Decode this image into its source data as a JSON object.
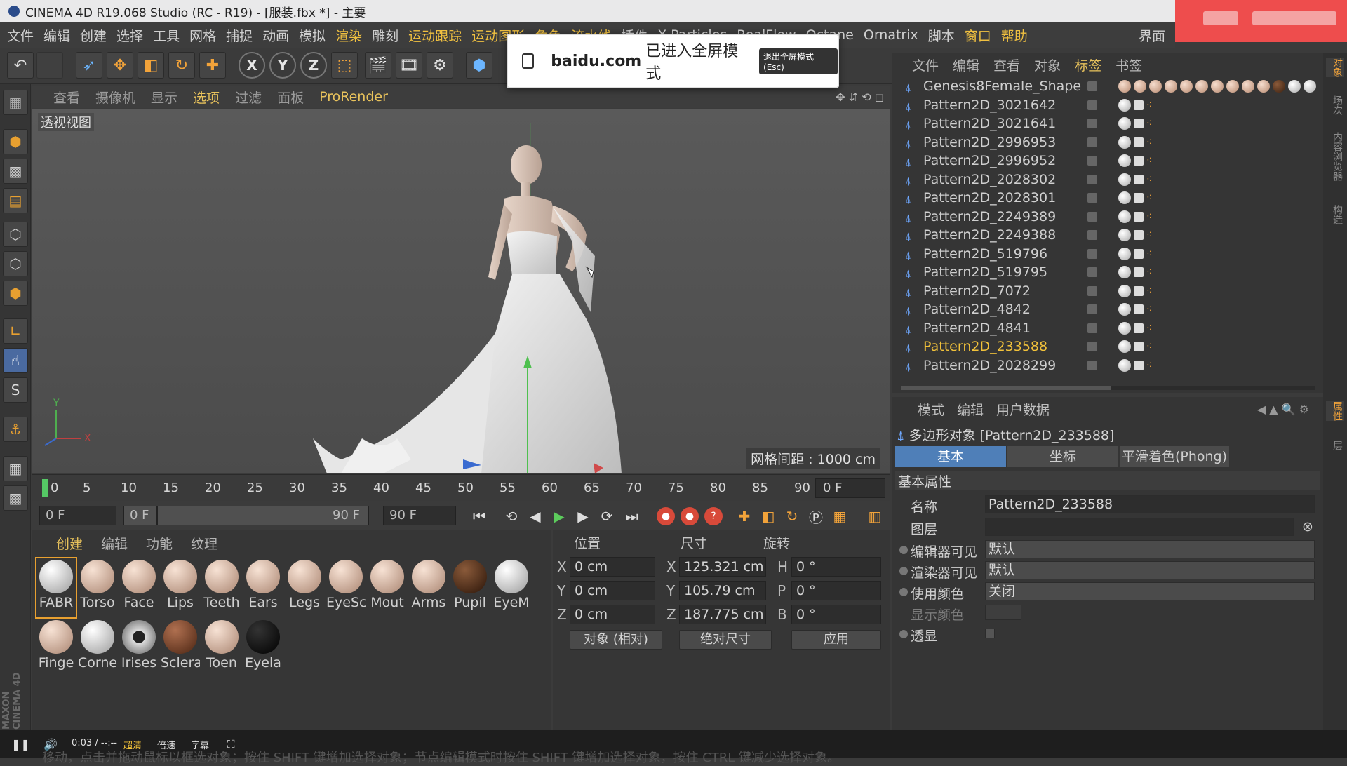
{
  "titlebar": {
    "title": "CINEMA 4D R19.068 Studio (RC - R19) - [服装.fbx *] - 主要"
  },
  "menubar": {
    "items": [
      "文件",
      "编辑",
      "创建",
      "选择",
      "工具",
      "网格",
      "捕捉",
      "动画",
      "模拟",
      "渲染",
      "雕刻",
      "运动跟踪",
      "运动图形",
      "角色",
      "流水线",
      "插件",
      "X-Particles",
      "RealFlow",
      "Octane",
      "Ornatrix",
      "脚本",
      "窗口",
      "帮助"
    ],
    "right_item": "界面"
  },
  "fullscreen_banner": {
    "host": "baidu.com",
    "message": "已进入全屏模式",
    "exit_button": "退出全屏模式 (Esc)"
  },
  "toolbar": {
    "axis_x": "X",
    "axis_y": "Y",
    "axis_z": "Z"
  },
  "viewport_menu": {
    "items": [
      "查看",
      "摄像机",
      "显示",
      "选项",
      "过滤",
      "面板"
    ],
    "selected": "选项",
    "prorender": "ProRender"
  },
  "viewport": {
    "label": "透视视图",
    "grid_spacing": "网格间距 : 1000 cm"
  },
  "timeline": {
    "ticks": [
      "0",
      "5",
      "10",
      "15",
      "20",
      "25",
      "30",
      "35",
      "40",
      "45",
      "50",
      "55",
      "60",
      "65",
      "70",
      "75",
      "80",
      "85",
      "90"
    ],
    "current_frame_box": "0 F"
  },
  "transport": {
    "start_frame": "0 F",
    "range_start": "0 F",
    "range_end": "90 F",
    "end_frame": "90 F"
  },
  "materials": {
    "tabs": [
      "创建",
      "编辑",
      "功能",
      "纹理"
    ],
    "items": [
      {
        "name": "FABR",
        "type": "white"
      },
      {
        "name": "Torso",
        "type": "skin"
      },
      {
        "name": "Face",
        "type": "skin"
      },
      {
        "name": "Lips",
        "type": "skin"
      },
      {
        "name": "Teeth",
        "type": "skin"
      },
      {
        "name": "Ears",
        "type": "skin"
      },
      {
        "name": "Legs",
        "type": "skin"
      },
      {
        "name": "EyeSc",
        "type": "skin"
      },
      {
        "name": "Mout",
        "type": "skin"
      },
      {
        "name": "Arms",
        "type": "skin"
      },
      {
        "name": "Pupil",
        "type": "brown"
      },
      {
        "name": "EyeM",
        "type": "white"
      },
      {
        "name": "Finge",
        "type": "skin"
      },
      {
        "name": "Corne",
        "type": "white"
      },
      {
        "name": "Irises",
        "type": "iris"
      },
      {
        "name": "Sclera",
        "type": "brown2"
      },
      {
        "name": "Toen",
        "type": "skin"
      },
      {
        "name": "Eyela",
        "type": "black"
      }
    ]
  },
  "coords": {
    "headers": {
      "position": "位置",
      "size": "尺寸",
      "rotation": "旋转"
    },
    "pos_labels": [
      "X",
      "Y",
      "Z"
    ],
    "size_labels": [
      "X",
      "Y",
      "Z"
    ],
    "rot_labels": [
      "H",
      "P",
      "B"
    ],
    "position": [
      "0 cm",
      "0 cm",
      "0 cm"
    ],
    "size": [
      "125.321 cm",
      "105.79 cm",
      "187.775 cm"
    ],
    "rotation": [
      "0 °",
      "0 °",
      "0 °"
    ],
    "mode_dropdown": "对象 (相对)",
    "size_dropdown": "绝对尺寸",
    "apply_button": "应用"
  },
  "objects": {
    "menu": [
      "文件",
      "编辑",
      "查看",
      "对象",
      "标签",
      "书签"
    ],
    "menu_selected": "标签",
    "rows": [
      "Genesis8Female_Shape",
      "Pattern2D_3021642",
      "Pattern2D_3021641",
      "Pattern2D_2996953",
      "Pattern2D_2996952",
      "Pattern2D_2028302",
      "Pattern2D_2028301",
      "Pattern2D_2249389",
      "Pattern2D_2249388",
      "Pattern2D_519796",
      "Pattern2D_519795",
      "Pattern2D_7072",
      "Pattern2D_4842",
      "Pattern2D_4841",
      "Pattern2D_233588",
      "Pattern2D_2028299"
    ],
    "active_row": "Pattern2D_233588"
  },
  "attributes": {
    "menu": [
      "模式",
      "编辑",
      "用户数据"
    ],
    "title": "多边形对象 [Pattern2D_233588]",
    "tabs": [
      "基本",
      "坐标",
      "平滑着色(Phong)"
    ],
    "selected_tab": "基本",
    "section": "基本属性",
    "fields": {
      "name_label": "名称",
      "name_value": "Pattern2D_233588",
      "layer_label": "图层",
      "layer_value": "",
      "editor_vis_label": "编辑器可见",
      "editor_vis_value": "默认",
      "render_vis_label": "渲染器可见",
      "render_vis_value": "默认",
      "use_color_label": "使用颜色",
      "use_color_value": "关闭",
      "display_color_label": "显示颜色",
      "xray_label": "透显"
    }
  },
  "right_tabs": [
    "对象",
    "场次",
    "内容浏览器",
    "构造",
    "属性",
    "层"
  ],
  "player": {
    "time": "0:03 / --:--",
    "quality": "超清",
    "speed": "倍速",
    "subtitle": "字幕",
    "caption": "移动，点击并拖动鼠标以框选对象；按住 SHIFT 键增加选择对象；节点编辑模式时按住 SHIFT 键增加选择对象，按住 CTRL 键减少选择对象。"
  },
  "colors": {
    "accent": "#e8c25c",
    "selection_blue": "#4f7fb8",
    "orange": "#f2a33a",
    "redbar": "#ee4d4d"
  }
}
